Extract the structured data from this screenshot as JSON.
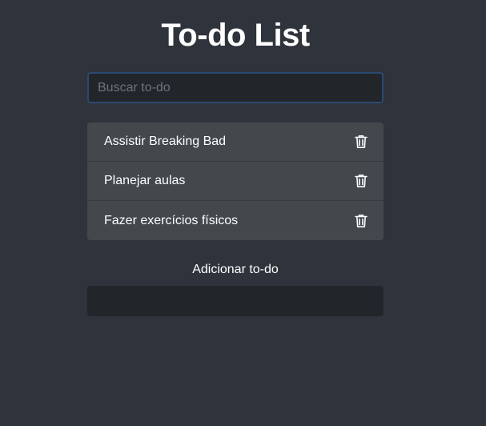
{
  "header": {
    "title": "To-do List"
  },
  "search": {
    "placeholder": "Buscar to-do",
    "value": ""
  },
  "todos": [
    {
      "label": "Assistir Breaking Bad",
      "action_icon": "trash-icon"
    },
    {
      "label": "Planejar aulas",
      "action_icon": "trash-icon"
    },
    {
      "label": "Fazer exercícios físicos",
      "action_icon": "trash-icon"
    }
  ],
  "add_form": {
    "label": "Adicionar to-do",
    "value": ""
  },
  "colors": {
    "background": "#2f333b",
    "input_background": "#22262b",
    "list_background": "#43484d",
    "focus_border": "#2a4a72",
    "text": "#ffffff"
  }
}
